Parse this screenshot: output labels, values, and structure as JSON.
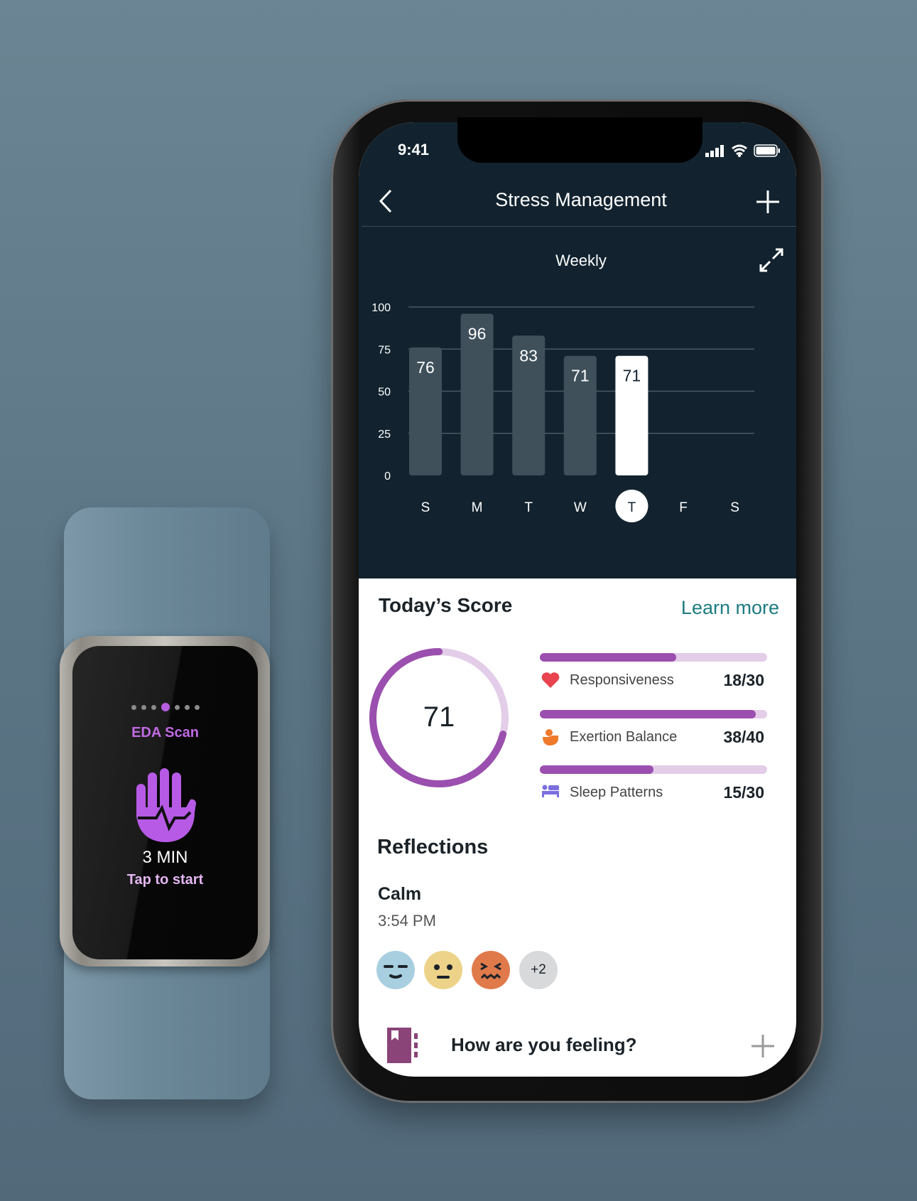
{
  "tracker": {
    "page_dots": 7,
    "active_dot": 3,
    "title": "EDA Scan",
    "duration": "3 MIN",
    "action": "Tap to start"
  },
  "status_bar": {
    "time": "9:41"
  },
  "header": {
    "title": "Stress Management",
    "back_icon": "chevron-left-icon",
    "add_icon": "plus-icon"
  },
  "chart_header": {
    "title": "Weekly",
    "expand_icon": "expand-icon"
  },
  "chart_data": {
    "type": "bar",
    "title": "Weekly",
    "categories": [
      "S",
      "M",
      "T",
      "W",
      "T",
      "F",
      "S"
    ],
    "values": [
      76,
      96,
      83,
      71,
      71,
      null,
      null
    ],
    "selected_index": 4,
    "yticks": [
      "0",
      "25",
      "50",
      "75",
      "100"
    ],
    "ylim": [
      0,
      100
    ],
    "grid": true,
    "colors": {
      "bar": "#3f505b",
      "selected": "#ffffff"
    }
  },
  "score": {
    "title": "Today’s Score",
    "learn_more": "Learn more",
    "value": "71",
    "fraction": 0.71,
    "accent": "#9b4fae",
    "track": "#e3cde8",
    "metrics": [
      {
        "label": "Responsiveness",
        "value": "18/30",
        "fraction": 0.6,
        "icon": "heart-icon"
      },
      {
        "label": "Exertion Balance",
        "value": "38/40",
        "fraction": 0.95,
        "icon": "exertion-icon"
      },
      {
        "label": "Sleep Patterns",
        "value": "15/30",
        "fraction": 0.5,
        "icon": "bed-icon"
      }
    ]
  },
  "reflections": {
    "title": "Reflections",
    "mood": "Calm",
    "time": "3:54 PM",
    "moods": [
      "calm-face-icon",
      "neutral-face-icon",
      "stressed-face-icon"
    ],
    "more": "+2",
    "prompt": "How are you feeling?"
  }
}
